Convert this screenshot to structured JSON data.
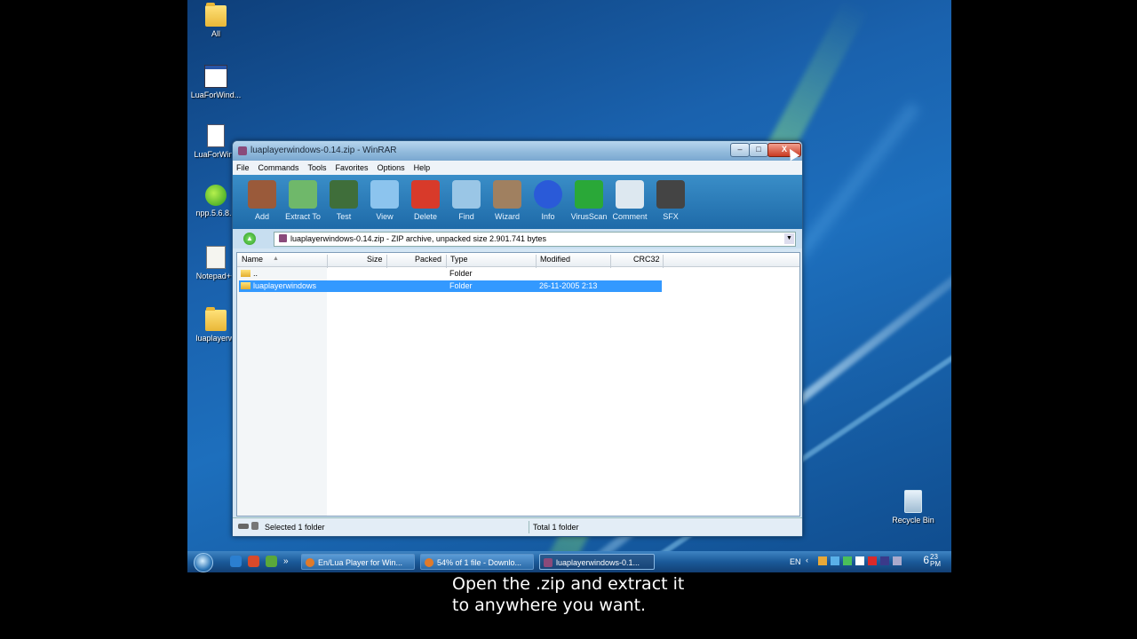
{
  "desktop": {
    "icons": [
      {
        "label": "All",
        "type": "folder"
      },
      {
        "label": "LuaForWind...",
        "type": "app"
      },
      {
        "label": "LuaForWind",
        "type": "doc"
      },
      {
        "label": "npp.5.6.8.1",
        "type": "app"
      },
      {
        "label": "Notepad++",
        "type": "app"
      },
      {
        "label": "luaplayerwi",
        "type": "folder"
      },
      {
        "label": "Recycle Bin",
        "type": "bin"
      }
    ]
  },
  "window": {
    "title": "luaplayerwindows-0.14.zip - WinRAR",
    "controls": {
      "minimize": "–",
      "maximize": "□",
      "close": "X"
    },
    "menu": [
      "File",
      "Commands",
      "Tools",
      "Favorites",
      "Options",
      "Help"
    ],
    "toolbar": [
      {
        "label": "Add",
        "color": "#9a5a3a"
      },
      {
        "label": "Extract To",
        "color": "#6fb86a"
      },
      {
        "label": "Test",
        "color": "#3f6e3a"
      },
      {
        "label": "View",
        "color": "#8cc4ee"
      },
      {
        "label": "Delete",
        "color": "#d83a2a"
      },
      {
        "label": "Find",
        "color": "#9ac6e6"
      },
      {
        "label": "Wizard",
        "color": "#a08060"
      },
      {
        "label": "Info",
        "color": "#2a5ad8"
      },
      {
        "label": "VirusScan",
        "color": "#2aa838"
      },
      {
        "label": "Comment",
        "color": "#dde8f0"
      },
      {
        "label": "SFX",
        "color": "#444"
      }
    ],
    "address": "luaplayerwindows-0.14.zip - ZIP archive, unpacked size 2.901.741 bytes",
    "columns": [
      "Name",
      "Size",
      "Packed",
      "Type",
      "Modified",
      "CRC32"
    ],
    "rows": [
      {
        "name": "..",
        "size": "",
        "packed": "",
        "type": "Folder",
        "modified": "",
        "crc": "",
        "selected": false
      },
      {
        "name": "luaplayerwindows",
        "size": "",
        "packed": "",
        "type": "Folder",
        "modified": "26-11-2005 2:13",
        "crc": "",
        "selected": true
      }
    ],
    "status": {
      "left": "Selected 1 folder",
      "right": "Total 1 folder"
    }
  },
  "taskbar": {
    "tasks": [
      {
        "label": "En/Lua Player for Win...",
        "active": false
      },
      {
        "label": "54% of 1 file - Downlo...",
        "active": false
      },
      {
        "label": "luaplayerwindows-0.1...",
        "active": true
      }
    ],
    "lang": "EN",
    "clock": "6",
    "clock_min": "23",
    "clock_ampm": "PM"
  },
  "caption": {
    "line1": "Open the .zip and extract it",
    "line2": "to anywhere you want."
  }
}
